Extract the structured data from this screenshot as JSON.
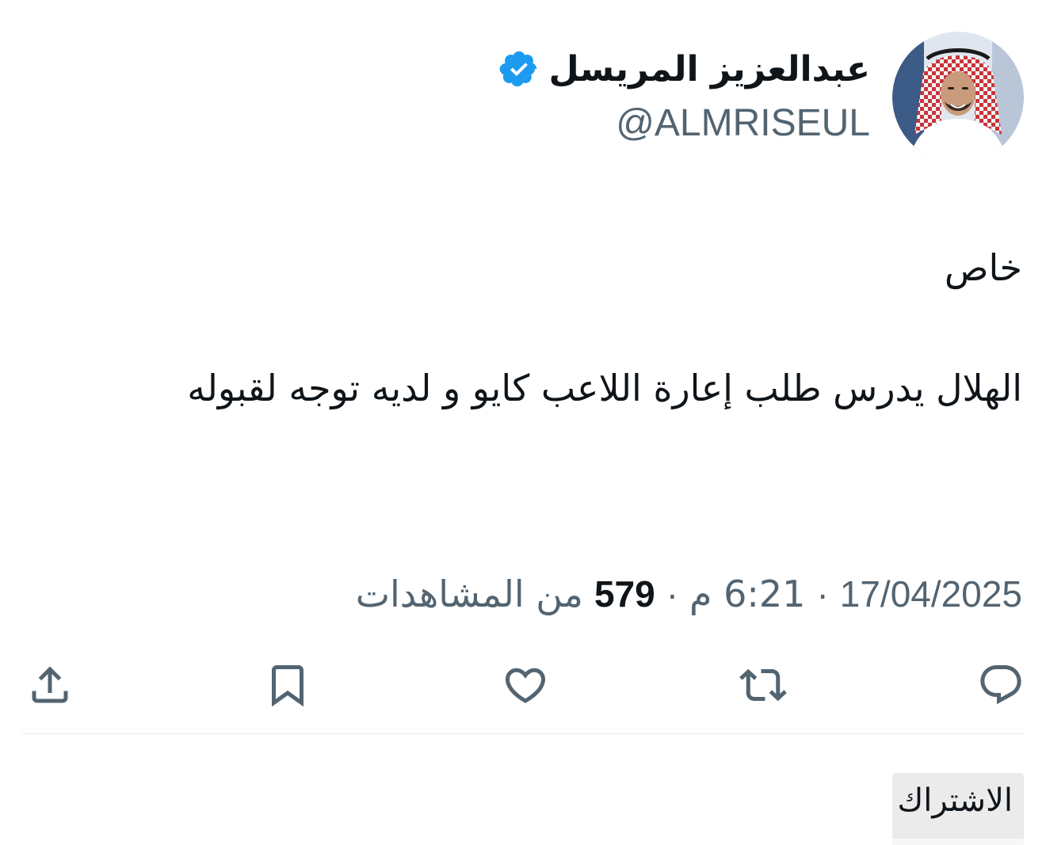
{
  "user": {
    "display_name": "عبدالعزيز المريسل",
    "handle": "@ALMRISEUL",
    "verified": true
  },
  "tweet": {
    "lines": [
      "خاص",
      "الهلال يدرس طلب إعارة اللاعب كايو و لديه توجه لقبوله"
    ]
  },
  "meta": {
    "date": "17/04/2025",
    "time": "6:21 م",
    "separator": "·",
    "views_count": "579",
    "views_label": "من المشاهدات"
  },
  "actions": {
    "reply_icon": "reply-icon",
    "retweet_icon": "retweet-icon",
    "like_icon": "heart-icon",
    "bookmark_icon": "bookmark-icon",
    "share_icon": "share-icon"
  },
  "bottom": {
    "subscribe_label": "الاشتراك"
  },
  "colors": {
    "text": "#0f1419",
    "secondary": "#536471",
    "verified": "#1d9bf0",
    "divider": "#e6e9ec"
  }
}
